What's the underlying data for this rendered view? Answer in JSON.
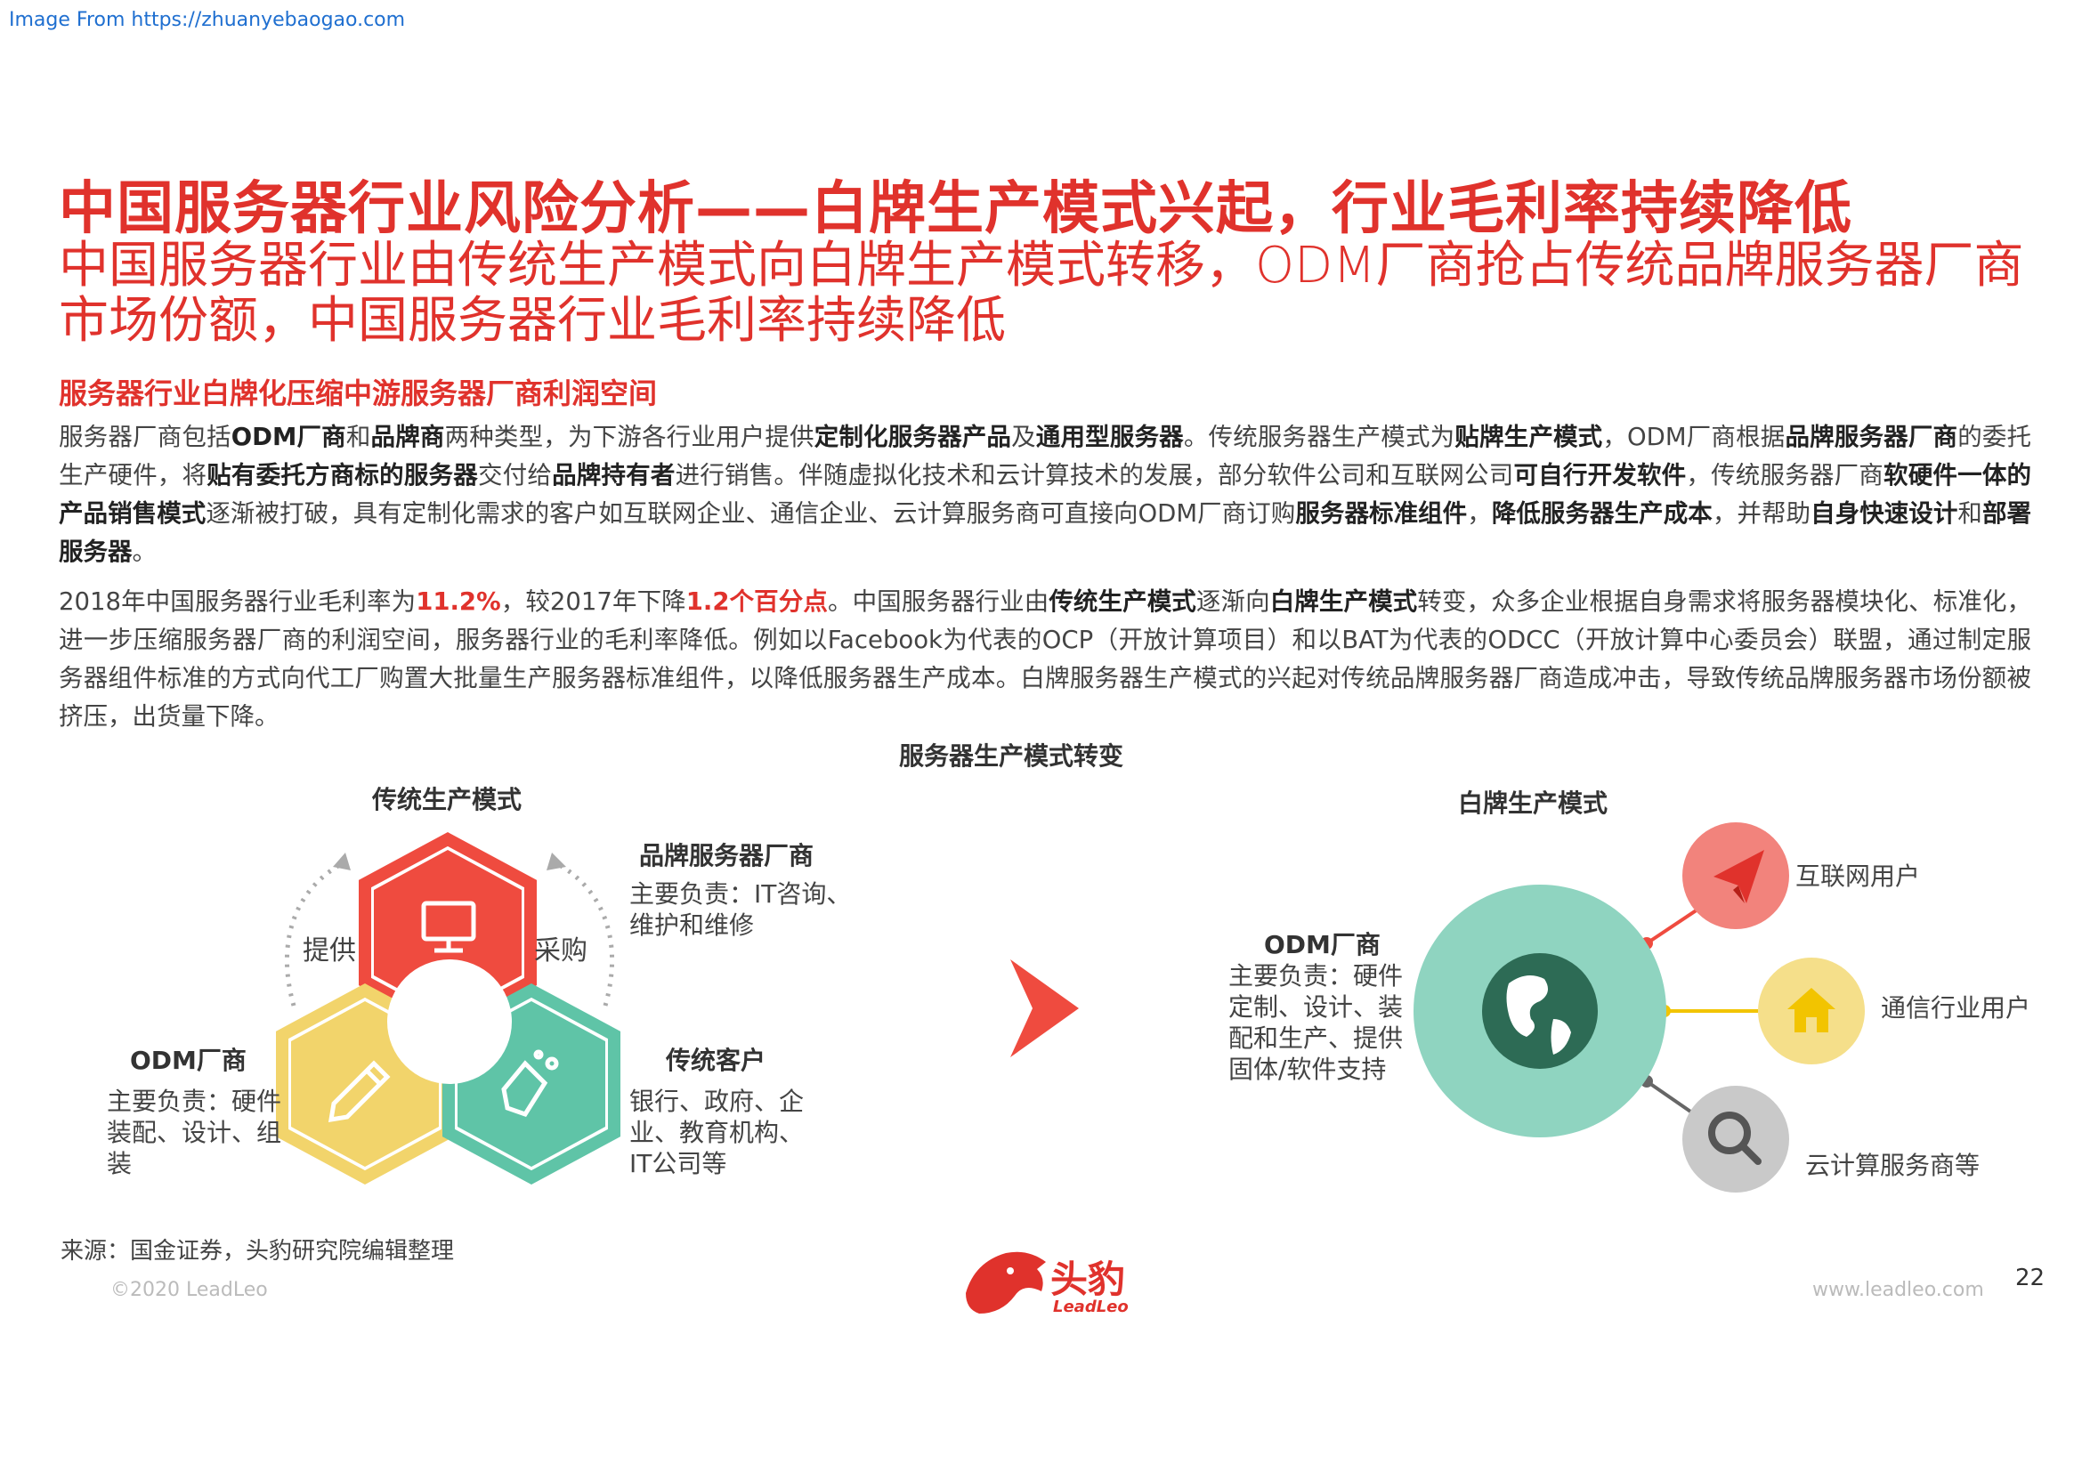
{
  "watermark": "Image From https://zhuanyebaogao.com",
  "title": "中国服务器行业风险分析——白牌生产模式兴起，行业毛利率持续降低",
  "subtitle": "中国服务器行业由传统生产模式向白牌生产模式转移，ODM厂商抢占传统品牌服务器厂商市场份额，中国服务器行业毛利率持续降低",
  "section_heading": "服务器行业白牌化压缩中游服务器厂商利润空间",
  "paragraph1": [
    {
      "t": "服务器厂商包括"
    },
    {
      "t": "ODM厂商",
      "b": true
    },
    {
      "t": "和"
    },
    {
      "t": "品牌商",
      "b": true
    },
    {
      "t": "两种类型，为下游各行业用户提供"
    },
    {
      "t": "定制化服务器产品",
      "b": true
    },
    {
      "t": "及"
    },
    {
      "t": "通用型服务器",
      "b": true
    },
    {
      "t": "。传统服务器生产模式为"
    },
    {
      "t": "贴牌生产模式",
      "b": true
    },
    {
      "t": "，ODM厂商根据"
    },
    {
      "t": "品牌服务器厂商",
      "b": true
    },
    {
      "t": "的委托生产硬件，将"
    },
    {
      "t": "贴有委托方商标的服务器",
      "b": true
    },
    {
      "t": "交付给"
    },
    {
      "t": "品牌持有者",
      "b": true
    },
    {
      "t": "进行销售。伴随虚拟化技术和云计算技术的发展，部分软件公司和互联网公司"
    },
    {
      "t": "可自行开发软件",
      "b": true
    },
    {
      "t": "，传统服务器厂商"
    },
    {
      "t": "软硬件一体的产品销售模式",
      "b": true
    },
    {
      "t": "逐渐被打破，具有定制化需求的客户如互联网企业、通信企业、云计算服务商可直接向ODM厂商订购"
    },
    {
      "t": "服务器标准组件",
      "b": true
    },
    {
      "t": "，"
    },
    {
      "t": "降低服务器生产成本",
      "b": true
    },
    {
      "t": "，并帮助"
    },
    {
      "t": "自身快速设计",
      "b": true
    },
    {
      "t": "和"
    },
    {
      "t": "部署服务器",
      "b": true
    },
    {
      "t": "。"
    }
  ],
  "paragraph2": [
    {
      "t": "2018年中国服务器行业毛利率为"
    },
    {
      "t": "11.2%",
      "hl": true
    },
    {
      "t": "，较2017年下降"
    },
    {
      "t": "1.2个百分点",
      "hl": true
    },
    {
      "t": "。中国服务器行业由"
    },
    {
      "t": "传统生产模式",
      "b": true
    },
    {
      "t": "逐渐向"
    },
    {
      "t": "白牌生产模式",
      "b": true
    },
    {
      "t": "转变，众多企业根据自身需求将服务器模块化、标准化，进一步压缩服务器厂商的利润空间，服务器行业的毛利率降低。例如以Facebook为代表的OCP（开放计算项目）和以BAT为代表的ODCC（开放计算中心委员会）联盟，通过制定服务器组件标准的方式向代工厂购置大批量生产服务器标准组件，以降低服务器生产成本。白牌服务器生产模式的兴起对传统品牌服务器厂商造成冲击，导致传统品牌服务器市场份额被挤压，出货量下降。"
    }
  ],
  "diagram": {
    "title": "服务器生产模式转变",
    "traditional": {
      "title": "传统生产模式",
      "provide": "提供",
      "purchase": "采购",
      "brand": {
        "name": "品牌服务器厂商",
        "desc": "主要负责：IT咨询、维护和维修"
      },
      "odm": {
        "name": "ODM厂商",
        "desc": "主要负责：硬件装配、设计、组装"
      },
      "customer": {
        "name": "传统客户",
        "desc": "银行、政府、企业、教育机构、IT公司等"
      }
    },
    "whitebox": {
      "title": "白牌生产模式",
      "odm": {
        "name": "ODM厂商",
        "desc": "主要负责：硬件定制、设计、装配和生产、提供固体/软件支持"
      },
      "users": [
        "互联网用户",
        "通信行业用户",
        "云计算服务商等"
      ]
    },
    "colors": {
      "red": "#ef4b3f",
      "yellow": "#f2d46b",
      "teal": "#5fc4a7",
      "mint": "#8fd4c0",
      "pink": "#f2837c",
      "lightyellow": "#f5df8a",
      "grey": "#c9c9c9"
    }
  },
  "source": "来源：国金证券，头豹研究院编辑整理",
  "copyright": "©2020 LeadLeo",
  "website": "www.leadleo.com",
  "page_number": "22",
  "logo": {
    "cn": "头豹",
    "en": "LeadLeo"
  }
}
